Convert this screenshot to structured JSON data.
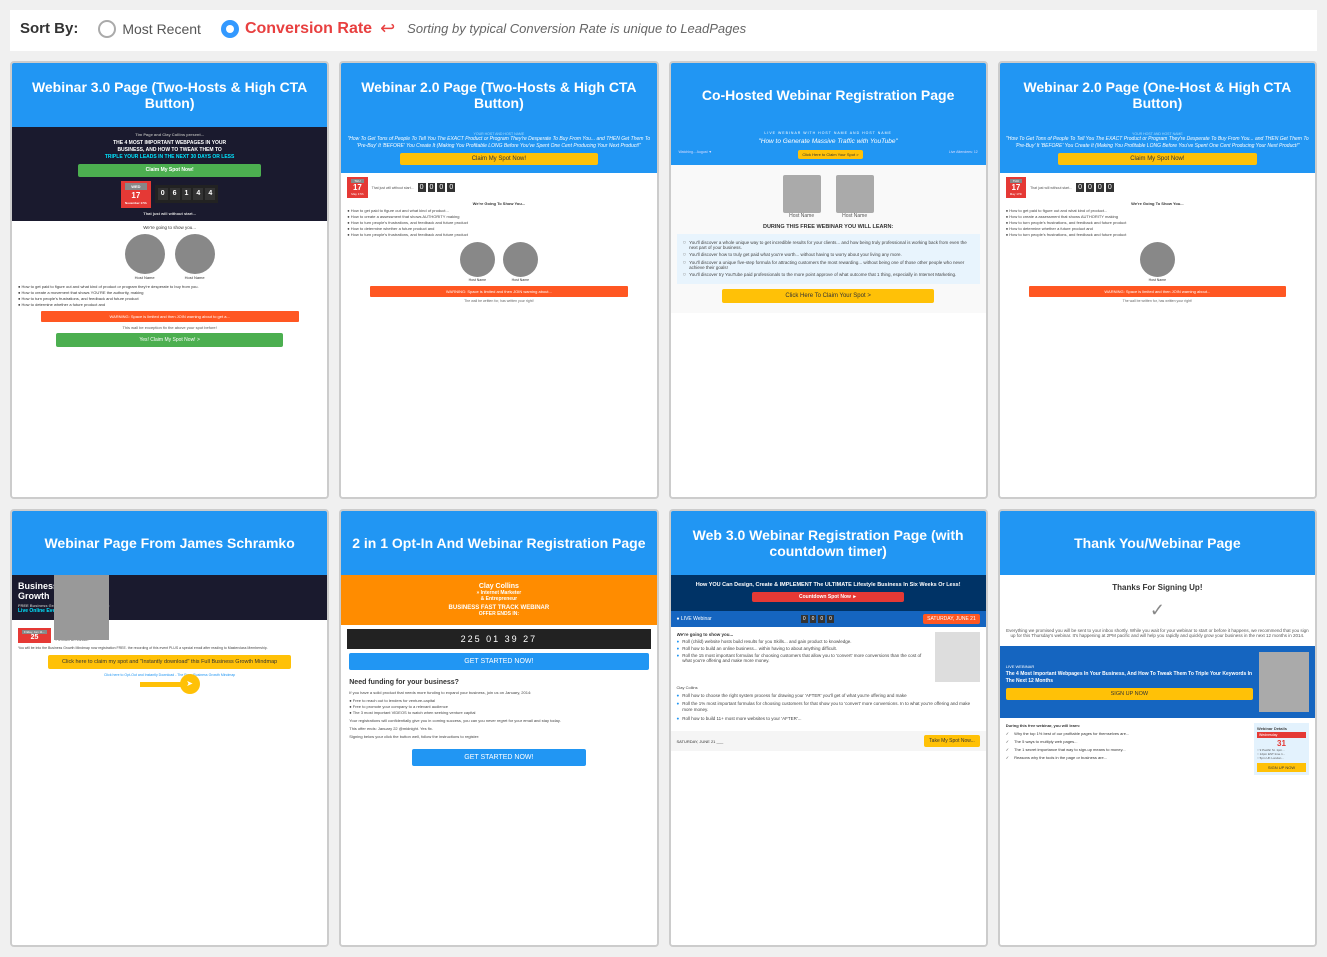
{
  "sortBar": {
    "label": "Sort By:",
    "mostRecentLabel": "Most Recent",
    "conversionRateLabel": "Conversion Rate",
    "sortNote": "Sorting by typical Conversion Rate is unique to LeadPages",
    "selectedOption": "conversion-rate"
  },
  "cards": [
    {
      "id": "card-1",
      "title": "Webinar 3.0 Page (Two-Hosts & High CTA Button)",
      "row": 1
    },
    {
      "id": "card-2",
      "title": "Webinar 2.0 Page (Two-Hosts & High CTA Button)",
      "row": 1
    },
    {
      "id": "card-3",
      "title": "Co-Hosted Webinar Registration Page",
      "row": 1
    },
    {
      "id": "card-4",
      "title": "Webinar 2.0 Page (One-Host & High CTA Button)",
      "row": 1
    },
    {
      "id": "card-5",
      "title": "Webinar Page From James Schramko",
      "row": 2
    },
    {
      "id": "card-6",
      "title": "2 in 1 Opt-In And Webinar Registration Page",
      "row": 2
    },
    {
      "id": "card-7",
      "title": "Web 3.0 Webinar Registration Page (with countdown timer)",
      "row": 2
    },
    {
      "id": "card-8",
      "title": "Thank You/Webinar Page",
      "row": 2
    }
  ]
}
